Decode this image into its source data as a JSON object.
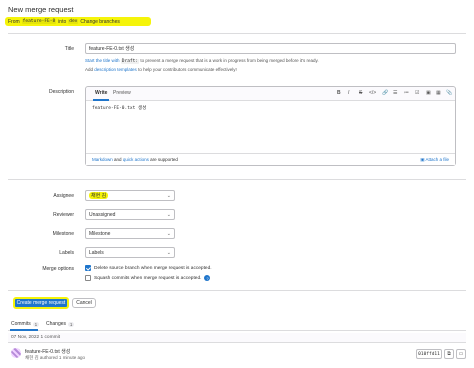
{
  "header": {
    "title": "New merge request",
    "from_prefix": "From",
    "source_branch": "feature-FE-8",
    "into_word": "into",
    "target_branch": "dev",
    "change_branches": "Change branches"
  },
  "form": {
    "title_label": "Title",
    "title_value": "feature-FE-0.txt 생성",
    "draft_help_start": "Start the title with",
    "draft_code": "Draft:",
    "draft_help_end": "to prevent a merge request that is a work in progress from being merged before it's ready.",
    "template_help_prefix": "Add",
    "template_help_link": "description templates",
    "template_help_suffix": "to help your contributors communicate effectively!",
    "description_label": "Description",
    "tab_write": "Write",
    "tab_preview": "Preview",
    "toolbar": {
      "bold": "B",
      "italic": "I",
      "strike": "S",
      "code": "</>",
      "link": "🔗",
      "ul": "☰",
      "ol": "≔",
      "task": "☑",
      "collapse": "▣",
      "table": "▦",
      "attach": "📎",
      "fullscreen": "⤢"
    },
    "description_value": "feature-FE-0.txt 생성",
    "md_text_link": "Markdown",
    "md_text_and": "and",
    "quick_actions_link": "quick actions",
    "md_text_supported": "are supported",
    "attach_file": "Attach a file",
    "assignee_label": "Assignee",
    "assignee_value": "채현 김",
    "reviewer_label": "Reviewer",
    "reviewer_value": "Unassigned",
    "milestone_label": "Milestone",
    "milestone_value": "Milestone",
    "labels_label": "Labels",
    "labels_value": "Labels",
    "merge_options_label": "Merge options",
    "delete_branch_option": "Delete source branch when merge request is accepted.",
    "squash_option": "Squash commits when merge request is accepted."
  },
  "actions": {
    "create_label": "Create merge request",
    "cancel_label": "Cancel"
  },
  "commits_tabs": {
    "commits_label": "Commits",
    "commits_count": "1",
    "changes_label": "Changes",
    "changes_count": "1"
  },
  "commit_list": {
    "day_label": "07 Nov, 2022 1 commit",
    "commit_title": "feature-FE-0.txt 생성",
    "commit_meta": "채현 김 authored 1 minute ago",
    "sha": "010ffd11",
    "copy_icon": "⧉",
    "browse_icon": "▭"
  },
  "colors": {
    "accent": "#1f75cb",
    "highlight": "#f5f40a"
  }
}
